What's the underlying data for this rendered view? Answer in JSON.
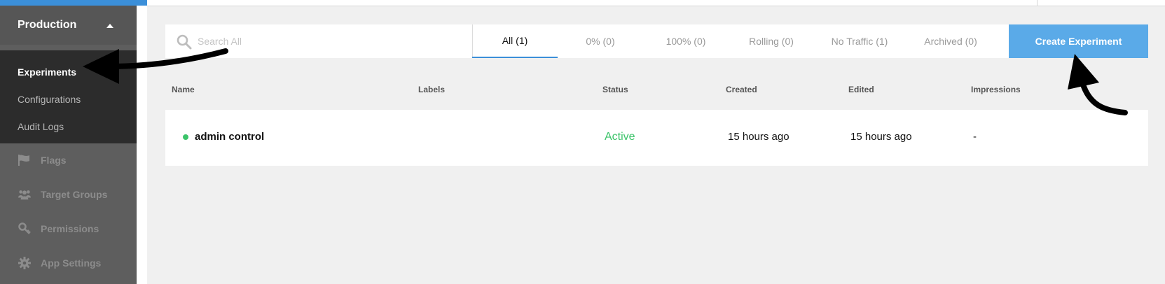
{
  "sidebar": {
    "environment": "Production",
    "sub_items": [
      {
        "label": "Experiments",
        "active": true
      },
      {
        "label": "Configurations",
        "active": false
      },
      {
        "label": "Audit Logs",
        "active": false
      }
    ],
    "nav_items": [
      {
        "label": "Flags",
        "icon": "flag-icon"
      },
      {
        "label": "Target Groups",
        "icon": "users-icon"
      },
      {
        "label": "Permissions",
        "icon": "key-icon"
      },
      {
        "label": "App Settings",
        "icon": "gear-icon"
      }
    ]
  },
  "toolbar": {
    "search_placeholder": "Search All",
    "tabs": [
      {
        "label": "All (1)",
        "active": true
      },
      {
        "label": "0% (0)",
        "active": false
      },
      {
        "label": "100% (0)",
        "active": false
      },
      {
        "label": "Rolling (0)",
        "active": false
      },
      {
        "label": "No Traffic (1)",
        "active": false
      },
      {
        "label": "Archived (0)",
        "active": false
      }
    ],
    "create_label": "Create Experiment"
  },
  "table": {
    "columns": [
      "Name",
      "Labels",
      "Status",
      "Created",
      "Edited",
      "Impressions"
    ],
    "rows": [
      {
        "name": "admin control",
        "labels": "",
        "status": "Active",
        "created": "15 hours ago",
        "edited": "15 hours ago",
        "impressions": "-"
      }
    ]
  },
  "colors": {
    "accent": "#3b8fd9",
    "button": "#5aaae8",
    "active_status": "#3cc46a",
    "sidebar": "#5e5e5e",
    "submenu": "#2c2c2c"
  }
}
